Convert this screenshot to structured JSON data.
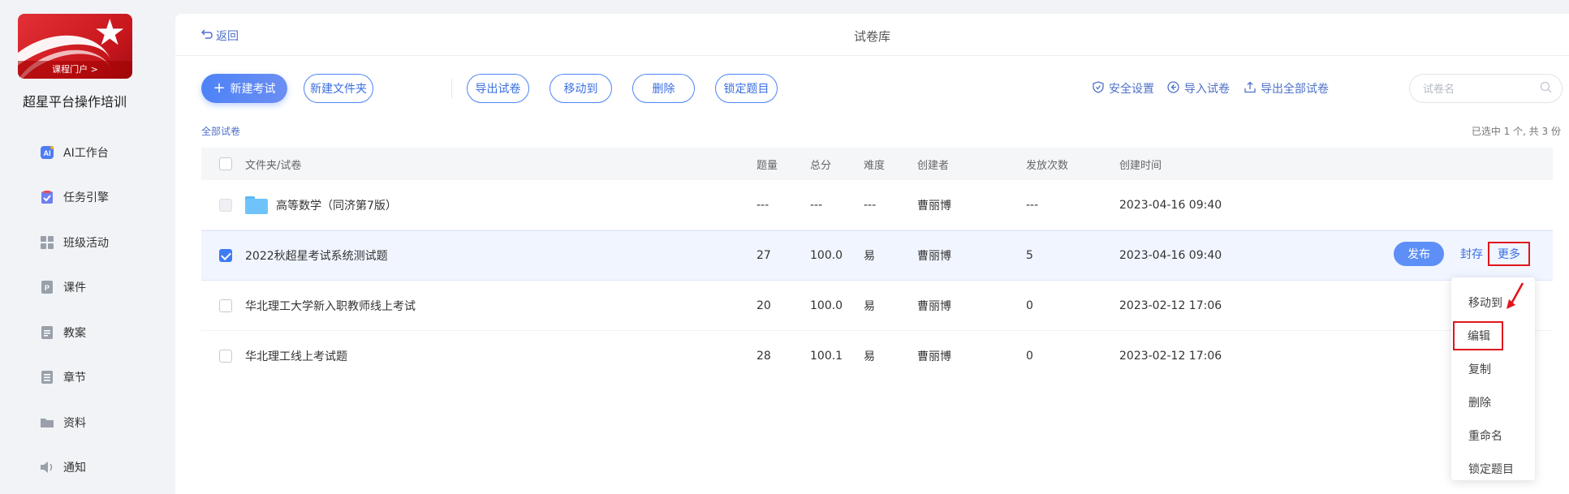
{
  "sidebar": {
    "logo_button": "课程门户 >",
    "org_name": "超星平台操作培训",
    "items": [
      {
        "label": "AI工作台",
        "icon": "ai-icon"
      },
      {
        "label": "任务引擎",
        "icon": "task-icon"
      },
      {
        "label": "班级活动",
        "icon": "grid-icon"
      },
      {
        "label": "课件",
        "icon": "ppt-icon"
      },
      {
        "label": "教案",
        "icon": "doc-icon"
      },
      {
        "label": "章节",
        "icon": "list-icon"
      },
      {
        "label": "资料",
        "icon": "folder-icon"
      },
      {
        "label": "通知",
        "icon": "speaker-icon"
      }
    ]
  },
  "header": {
    "back_label": "返回",
    "title": "试卷库"
  },
  "toolbar": {
    "new_exam": "新建考试",
    "new_folder": "新建文件夹",
    "export_paper": "导出试卷",
    "move_to": "移动到",
    "delete": "删除",
    "lock_questions": "锁定题目",
    "security": "安全设置",
    "import_paper": "导入试卷",
    "export_all": "导出全部试卷",
    "search_placeholder": "试卷名"
  },
  "breadcrumb": "全部试卷",
  "selection_info": "已选中 1 个, 共 3 份",
  "table": {
    "headers": {
      "name": "文件夹/试卷",
      "count": "题量",
      "score": "总分",
      "difficulty": "难度",
      "creator": "创建者",
      "times": "发放次数",
      "created": "创建时间"
    },
    "rows": [
      {
        "name": "高等数学（同济第7版）",
        "count": "---",
        "score": "---",
        "difficulty": "---",
        "creator": "曹丽博",
        "times": "---",
        "created": "2023-04-16 09:40"
      },
      {
        "name": "2022秋超星考试系统测试题",
        "count": "27",
        "score": "100.0",
        "difficulty": "易",
        "creator": "曹丽博",
        "times": "5",
        "created": "2023-04-16 09:40"
      },
      {
        "name": "华北理工大学新入职教师线上考试",
        "count": "20",
        "score": "100.0",
        "difficulty": "易",
        "creator": "曹丽博",
        "times": "0",
        "created": "2023-02-12 17:06"
      },
      {
        "name": "华北理工线上考试题",
        "count": "28",
        "score": "100.1",
        "difficulty": "易",
        "creator": "曹丽博",
        "times": "0",
        "created": "2023-02-12 17:06"
      }
    ]
  },
  "row_actions": {
    "publish": "发布",
    "seal": "封存",
    "more": "更多"
  },
  "dropdown": [
    "移动到",
    "编辑",
    "复制",
    "删除",
    "重命名",
    "锁定题目"
  ],
  "colors": {
    "accent": "#3a6fe0",
    "highlight_box": "#e0161d",
    "logo_red": "#d4242a"
  }
}
